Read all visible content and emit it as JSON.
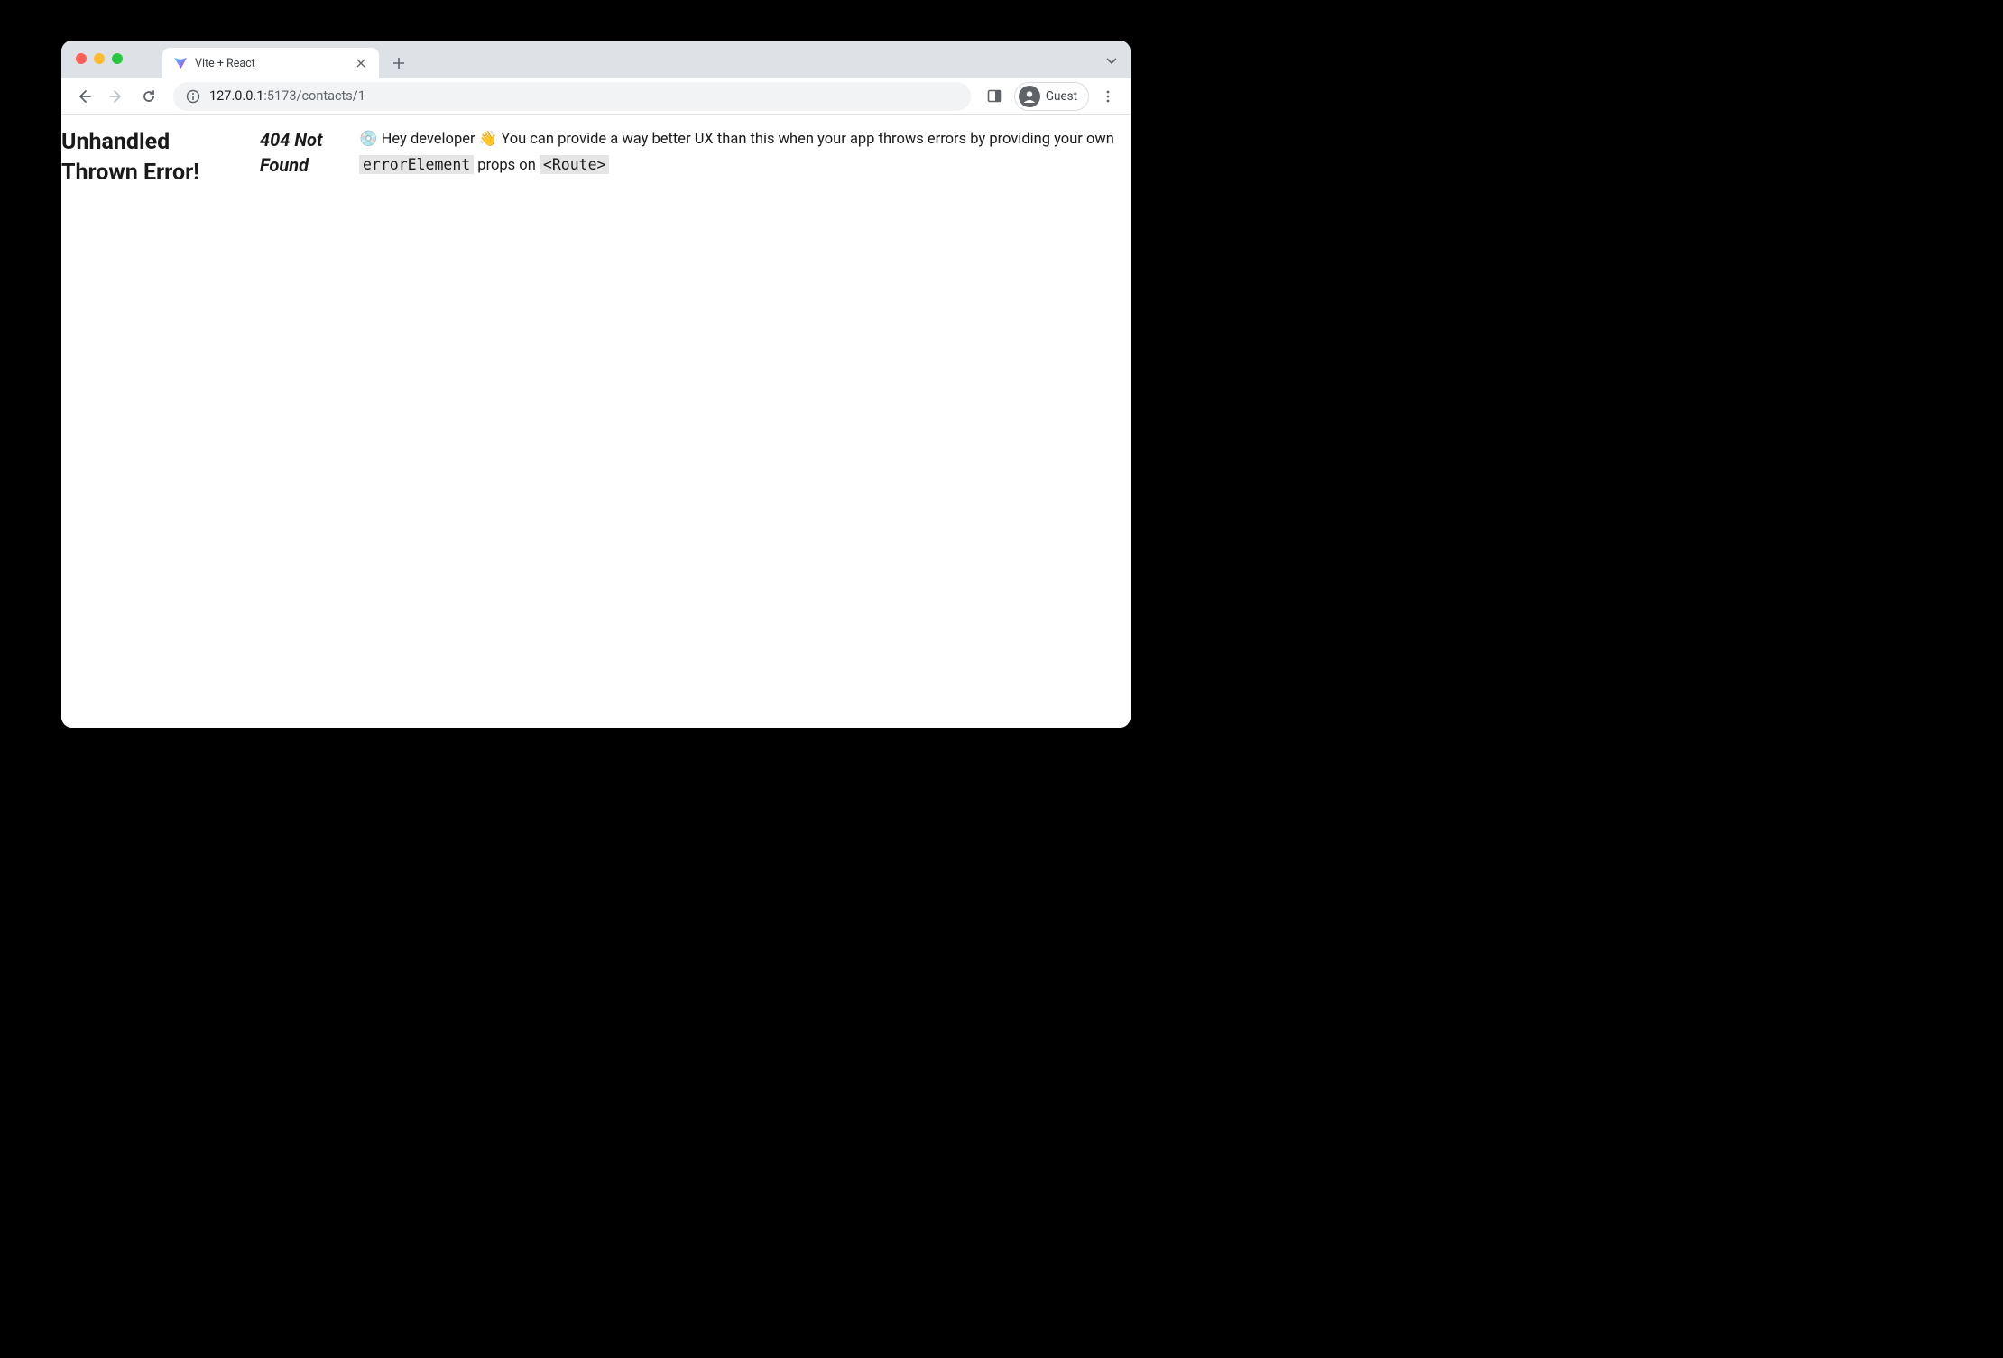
{
  "browser": {
    "tab": {
      "title": "Vite + React"
    },
    "url": {
      "host": "127.0.0.1",
      "port_path": ":5173/contacts/1"
    },
    "profile_label": "Guest"
  },
  "page": {
    "heading": "Unhandled Thrown Error!",
    "status": "404 Not Found",
    "msg_emoji1": "💿",
    "msg_part1": "Hey developer ",
    "msg_emoji2": "👋",
    "msg_part2": "You can provide a way better UX than this when your app throws errors by providing your own ",
    "msg_code1": "errorElement",
    "msg_part3": " props on ",
    "msg_code2": "<Route>"
  }
}
